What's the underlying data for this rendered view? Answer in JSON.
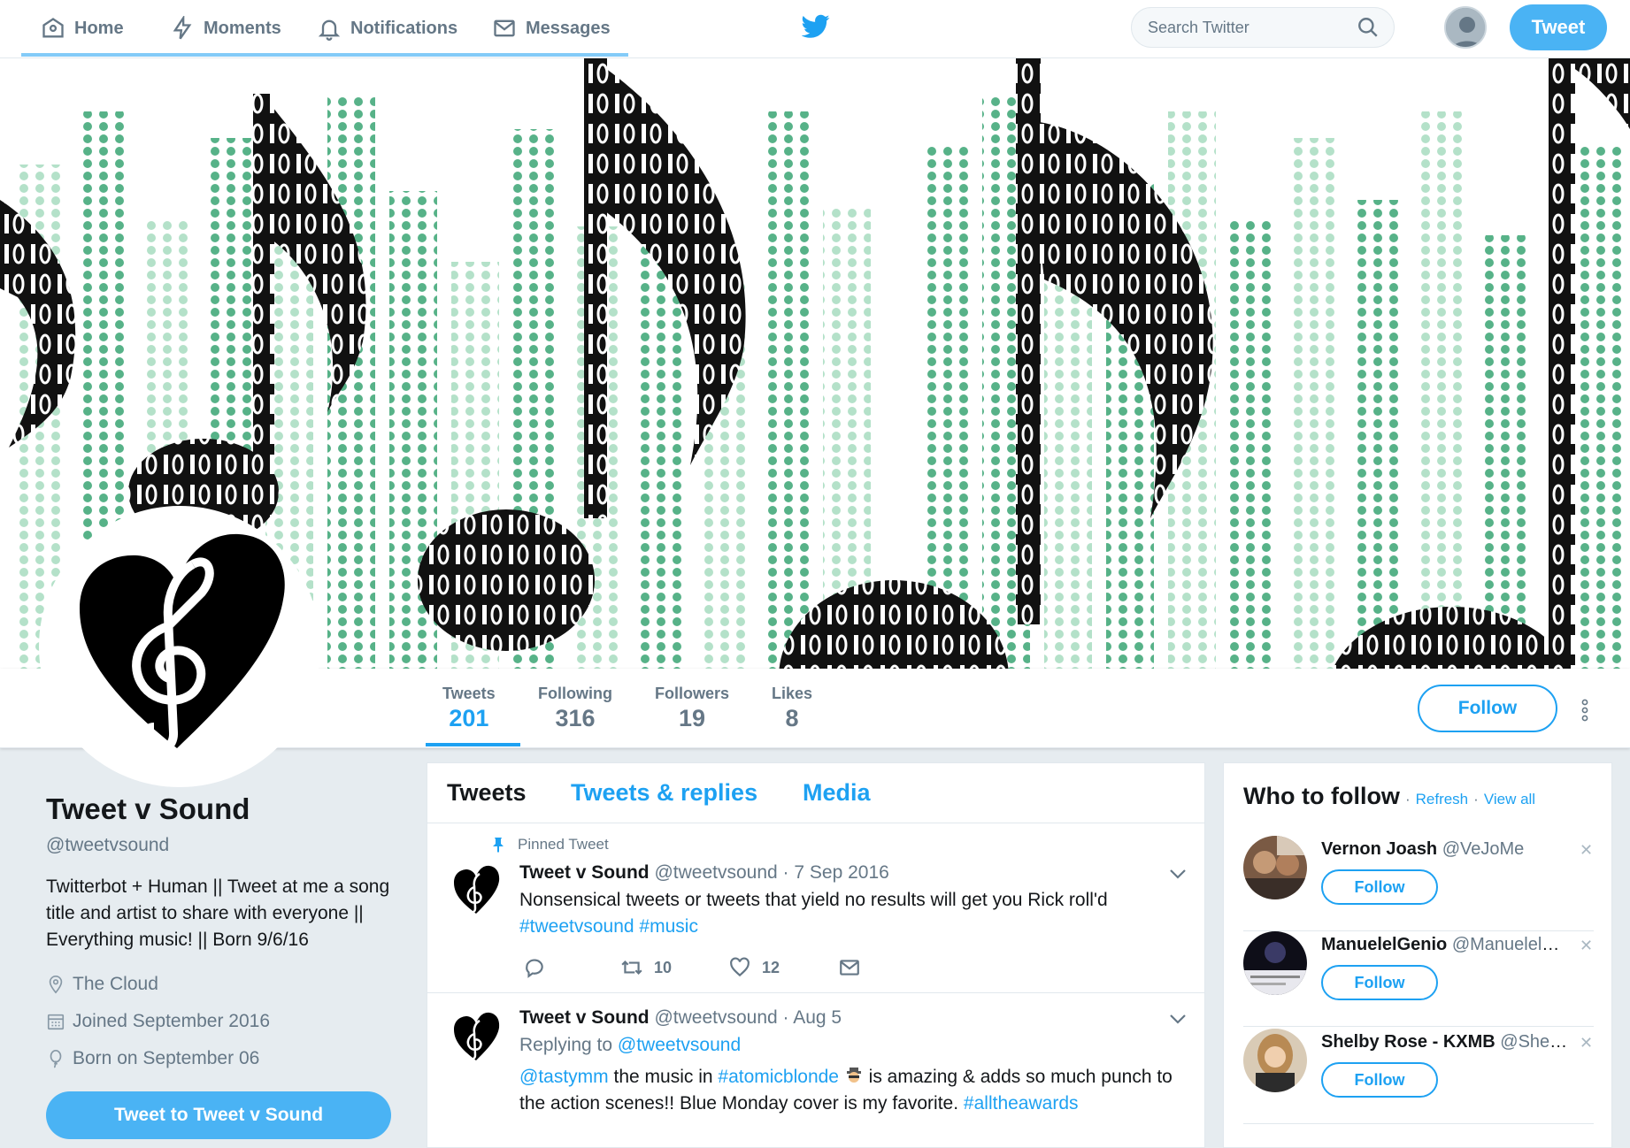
{
  "nav": {
    "items": [
      {
        "label": "Home",
        "icon": "home-icon"
      },
      {
        "label": "Moments",
        "icon": "lightning-icon"
      },
      {
        "label": "Notifications",
        "icon": "bell-icon"
      },
      {
        "label": "Messages",
        "icon": "envelope-icon"
      }
    ],
    "search_placeholder": "Search Twitter",
    "tweet_button": "Tweet"
  },
  "profile_nav": {
    "stats": [
      {
        "label": "Tweets",
        "value": "201"
      },
      {
        "label": "Following",
        "value": "316"
      },
      {
        "label": "Followers",
        "value": "19"
      },
      {
        "label": "Likes",
        "value": "8"
      }
    ],
    "follow_button": "Follow"
  },
  "profile": {
    "name": "Tweet v Sound",
    "handle": "@tweetvsound",
    "bio": "Twitterbot + Human || Tweet at me a song title and artist to share with everyone || Everything music! || Born 9/6/16",
    "location": "The Cloud",
    "joined": "Joined September 2016",
    "born": "Born on September 06",
    "tweet_to_button": "Tweet to Tweet v Sound"
  },
  "timeline": {
    "tabs": [
      "Tweets",
      "Tweets & replies",
      "Media"
    ],
    "tweets": [
      {
        "pinned_label": "Pinned Tweet",
        "name": "Tweet v Sound",
        "handle": "@tweetvsound",
        "date": "· 7 Sep 2016",
        "text": "Nonsensical tweets or tweets that yield no results will get you Rick roll'd",
        "hashtags": "#tweetvsound #music",
        "retweets": "10",
        "likes": "12"
      },
      {
        "name": "Tweet v Sound",
        "handle": "@tweetvsound",
        "date": "· Aug 5",
        "replying_prefix": "Replying to",
        "replying_to": "@tweetvsound",
        "mention": "@tastymm",
        "text1": "the music in",
        "hashtag1": "#atomicblonde",
        "text2": "is amazing & adds so much punch to the action scenes!! Blue Monday cover is my favorite.",
        "hashtag2": "#alltheawards"
      }
    ]
  },
  "who_to_follow": {
    "title": "Who to follow",
    "refresh": "Refresh",
    "view_all": "View all",
    "users": [
      {
        "name": "Vernon Joash",
        "handle": "@VeJoMe",
        "button": "Follow"
      },
      {
        "name": "ManuelelGenio",
        "handle": "@ManuelelGenio",
        "button": "Follow"
      },
      {
        "name": "Shelby Rose - KXMB",
        "handle": "@ShelbyRose",
        "button": "Follow"
      }
    ]
  },
  "colors": {
    "accent": "#1da1f2",
    "tweet_button": "#4ab3f4",
    "background": "#e6ecf0",
    "banner_green": "#2e9b6a"
  }
}
